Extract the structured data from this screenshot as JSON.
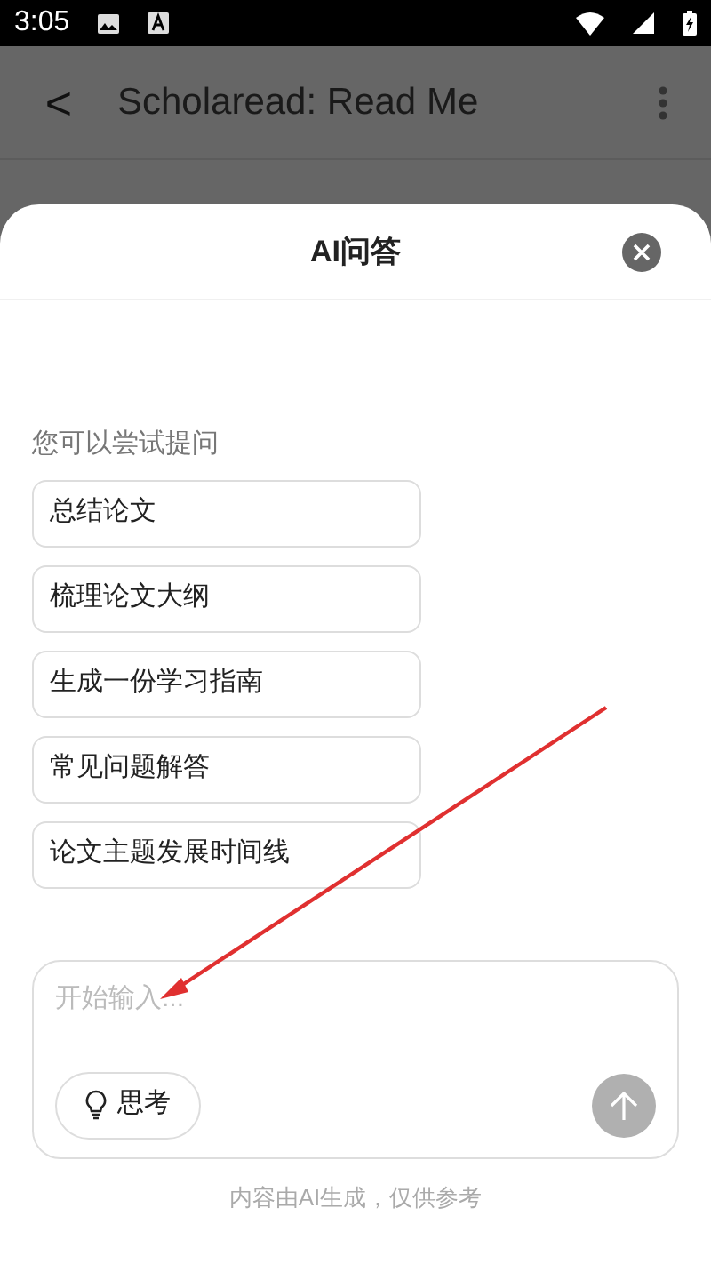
{
  "status_bar": {
    "time": "3:05"
  },
  "app_bar": {
    "back": "<",
    "title": "Scholaread: Read Me"
  },
  "sheet": {
    "title": "AI问答",
    "prompt_label": "您可以尝试提问",
    "suggestions": [
      "总结论文",
      "梳理论文大纲",
      "生成一份学习指南",
      "常见问题解答",
      "论文主题发展时间线"
    ],
    "input": {
      "placeholder": "开始输入..."
    },
    "think_button": "思考",
    "footer": "内容由AI生成，仅供参考"
  }
}
